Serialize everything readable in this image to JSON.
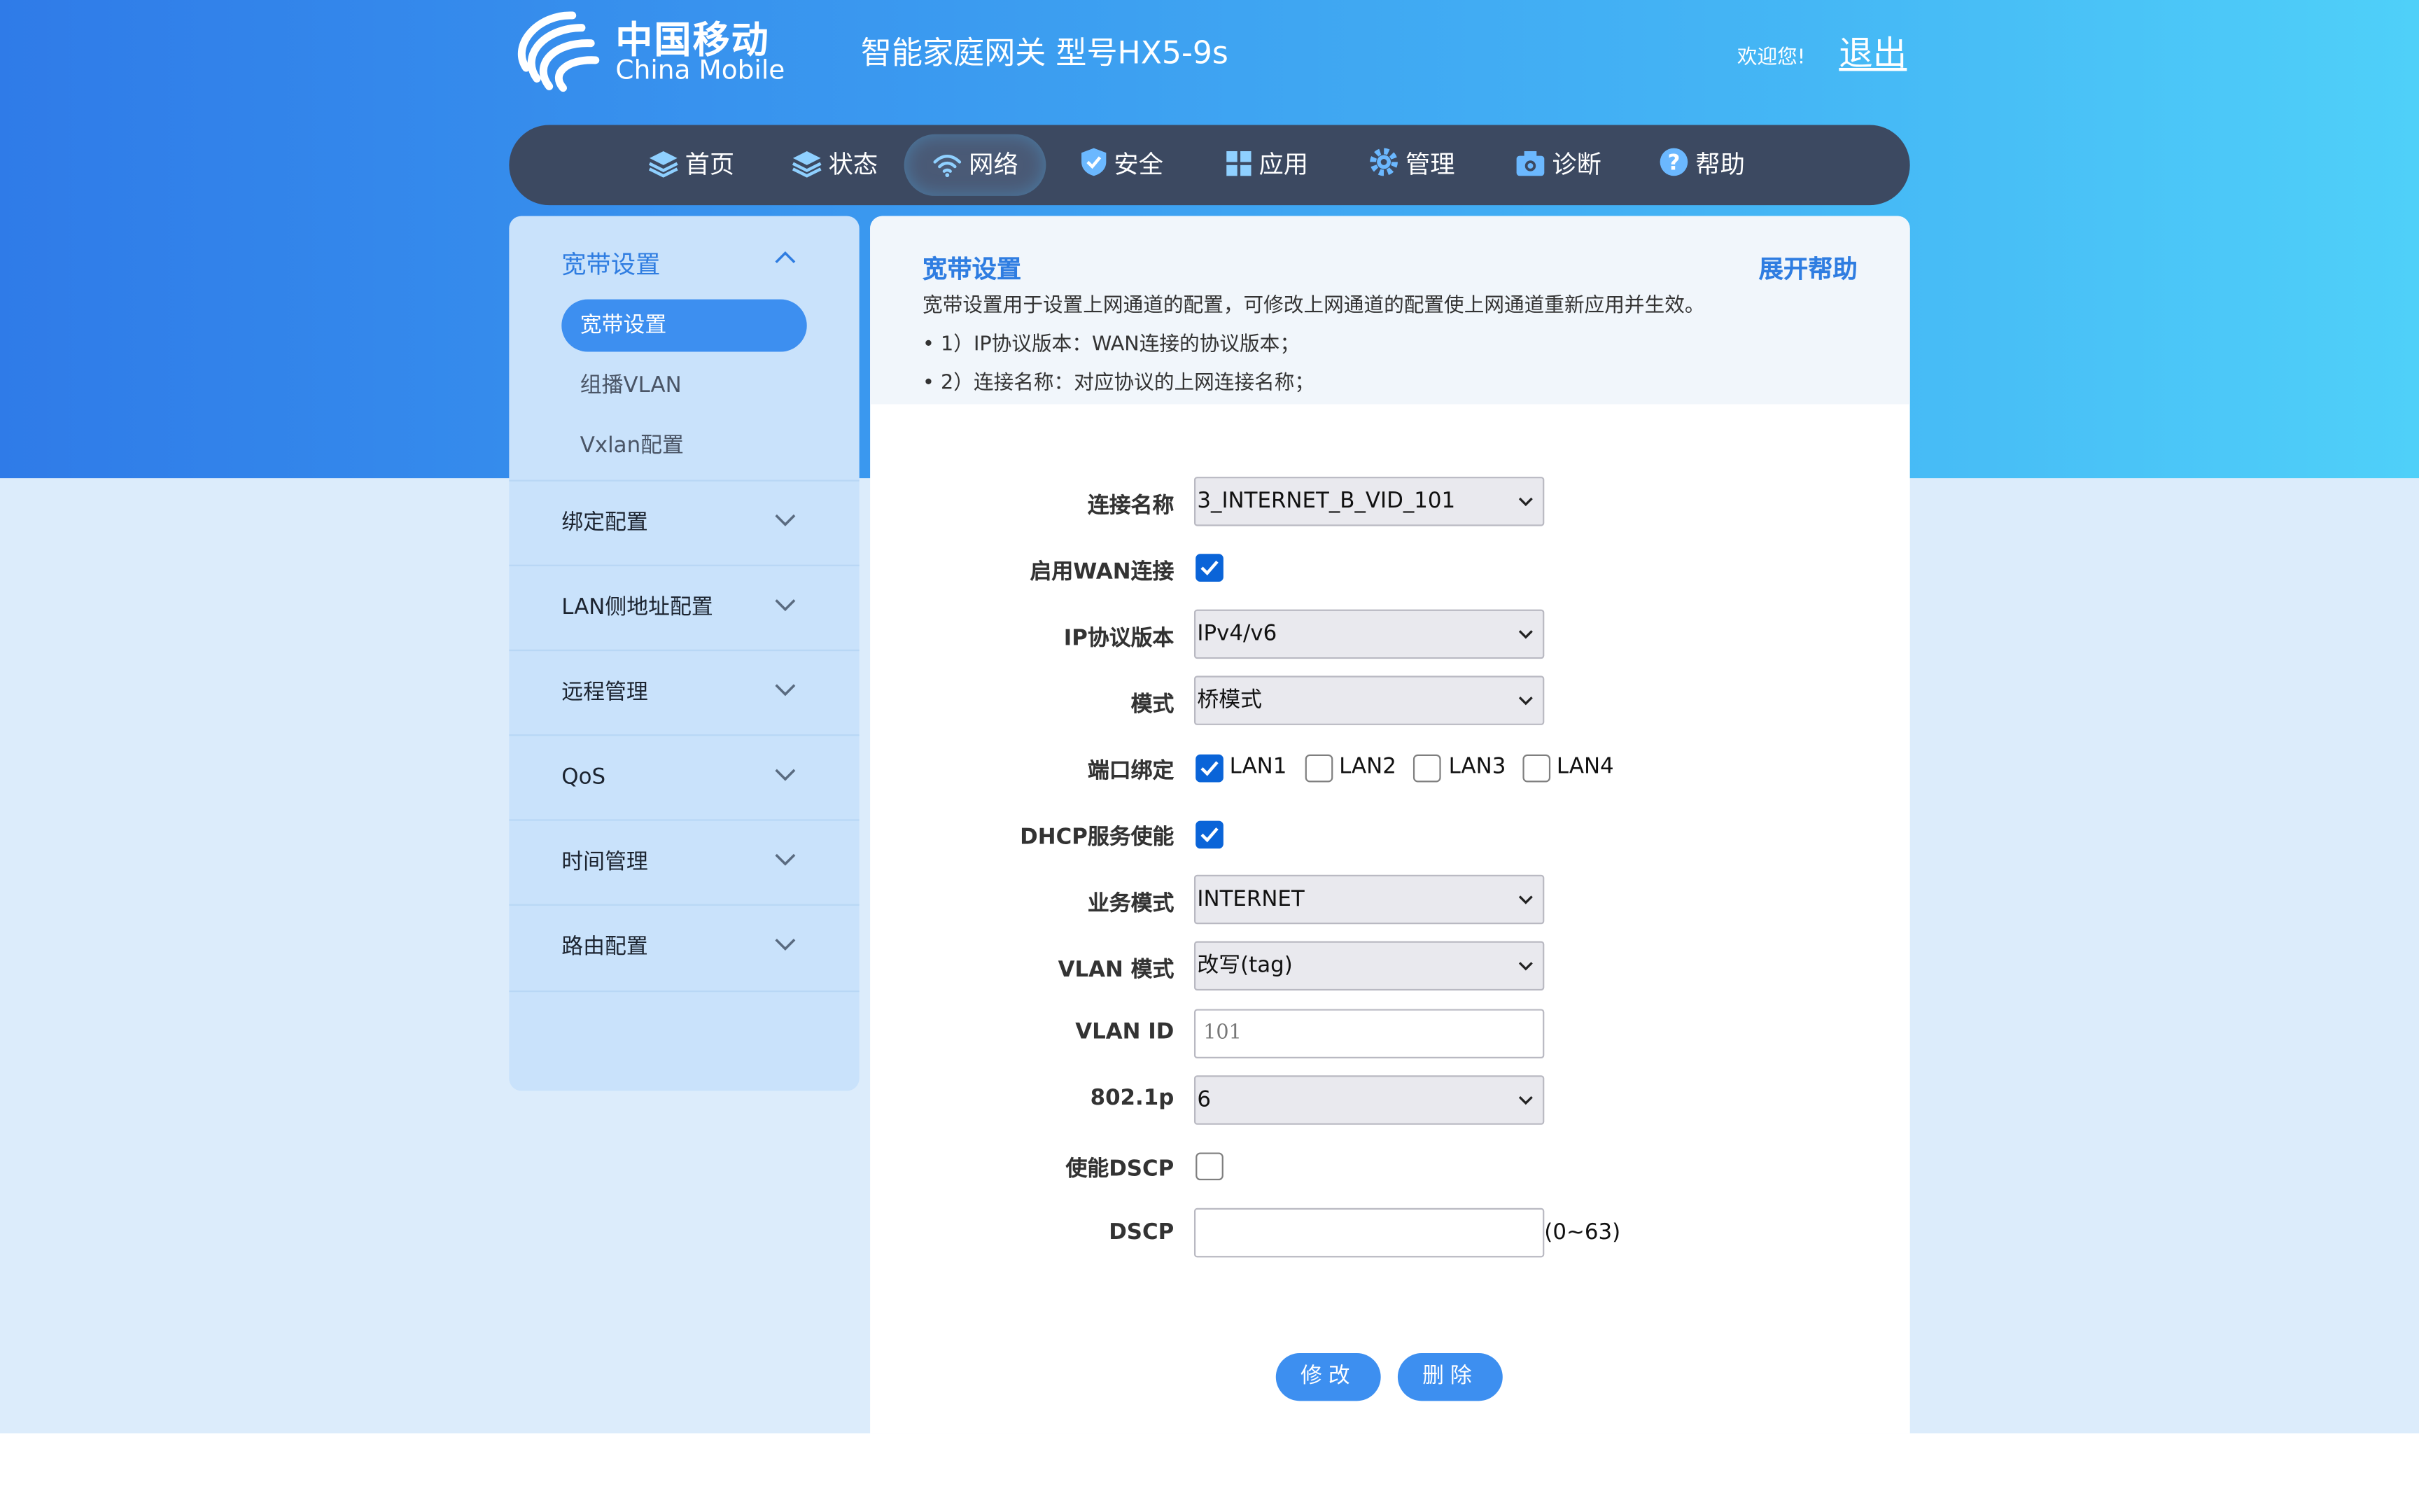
{
  "header": {
    "brand_cn": "中国移动",
    "brand_en": "China Mobile",
    "product_title": "智能家庭网关 型号HX5-9s",
    "welcome": "欢迎您!",
    "logout": "退出"
  },
  "nav": {
    "items": [
      {
        "label": "首页",
        "icon": "layers-icon"
      },
      {
        "label": "状态",
        "icon": "layers-icon"
      },
      {
        "label": "网络",
        "icon": "wifi-icon",
        "active": true
      },
      {
        "label": "安全",
        "icon": "shield-check-icon"
      },
      {
        "label": "应用",
        "icon": "grid-icon"
      },
      {
        "label": "管理",
        "icon": "gear-icon"
      },
      {
        "label": "诊断",
        "icon": "camera-icon"
      },
      {
        "label": "帮助",
        "icon": "question-icon"
      }
    ]
  },
  "sidebar": {
    "group_title": "宽带设置",
    "sub_items": [
      "宽带设置",
      "组播VLAN",
      "Vxlan配置"
    ],
    "active_sub": "宽带设置",
    "items": [
      "绑定配置",
      "LAN侧地址配置",
      "远程管理",
      "QoS",
      "时间管理",
      "路由配置"
    ]
  },
  "help": {
    "title": "宽带设置",
    "toggle": "展开帮助",
    "description": "宽带设置用于设置上网通道的配置，可修改上网通道的配置使上网通道重新应用并生效。",
    "bullets": [
      "• 1）IP协议版本：WAN连接的协议版本；",
      "• 2）连接名称：对应协议的上网连接名称；"
    ]
  },
  "form": {
    "connection_name": {
      "label": "连接名称",
      "value": "3_INTERNET_B_VID_101"
    },
    "enable_wan": {
      "label": "启用WAN连接",
      "checked": true
    },
    "ip_version": {
      "label": "IP协议版本",
      "value": "IPv4/v6"
    },
    "mode": {
      "label": "模式",
      "value": "桥模式"
    },
    "port_binding": {
      "label": "端口绑定",
      "ports": [
        {
          "name": "LAN1",
          "checked": true
        },
        {
          "name": "LAN2",
          "checked": false
        },
        {
          "name": "LAN3",
          "checked": false
        },
        {
          "name": "LAN4",
          "checked": false
        }
      ]
    },
    "dhcp": {
      "label": "DHCP服务使能",
      "checked": true
    },
    "service_mode": {
      "label": "业务模式",
      "value": "INTERNET"
    },
    "vlan_mode": {
      "label": "VLAN 模式",
      "value": "改写(tag)"
    },
    "vlan_id": {
      "label": "VLAN ID",
      "placeholder": "101"
    },
    "dot1p": {
      "label": "802.1p",
      "value": "6"
    },
    "enable_dscp": {
      "label": "使能DSCP",
      "checked": false
    },
    "dscp": {
      "label": "DSCP",
      "value": "",
      "hint": "(0~63)"
    }
  },
  "actions": {
    "modify": "修改",
    "delete": "删除"
  },
  "colors": {
    "accent": "#3d8ff0",
    "nav_bg": "#3c4961",
    "sidebar_bg": "#c9e2fb",
    "checkbox": "#0a64d8"
  }
}
